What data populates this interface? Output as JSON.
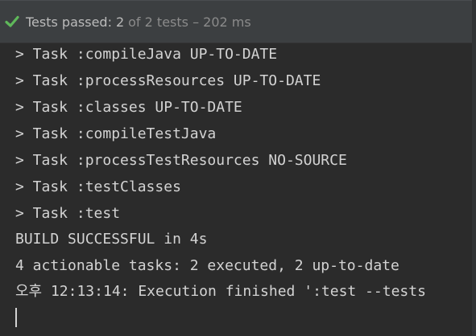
{
  "status": {
    "icon": "check-icon",
    "icon_color": "#5fb85a",
    "label": "Tests passed:",
    "passed_count": "2",
    "rest": "of 2 tests – 202 ms"
  },
  "console": {
    "lines": [
      "> Task :compileJava UP-TO-DATE",
      "> Task :processResources UP-TO-DATE",
      "> Task :classes UP-TO-DATE",
      "> Task :compileTestJava",
      "> Task :processTestResources NO-SOURCE",
      "> Task :testClasses",
      "> Task :test",
      "BUILD SUCCESSFUL in 4s",
      "4 actionable tasks: 2 executed, 2 up-to-date",
      "오후 12:13:14: Execution finished ':test --tests"
    ]
  }
}
